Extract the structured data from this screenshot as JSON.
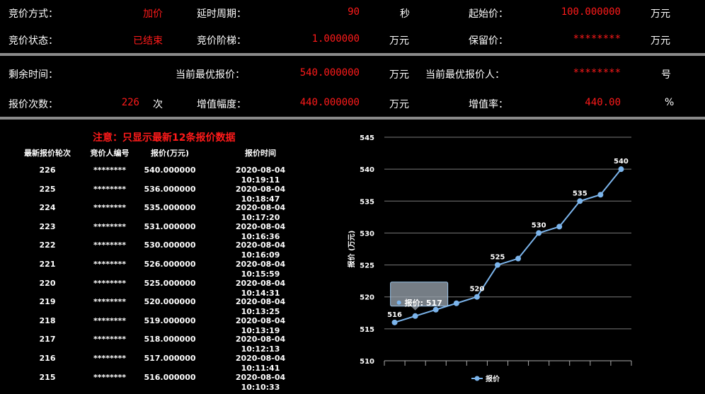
{
  "header": {
    "auction_type_label": "竞价方式：",
    "auction_type_value": "加价",
    "delay_period_label": "延时周期：",
    "delay_period_value": "90",
    "delay_period_unit": "秒",
    "start_price_label": "起始价：",
    "start_price_value": "100.000000",
    "start_price_unit": "万元",
    "status_label": "竞价状态：",
    "status_value": "已结束",
    "step_label": "竞价阶梯：",
    "step_value": "1.000000",
    "step_unit": "万元",
    "reserve_label": "保留价：",
    "reserve_value": "********",
    "reserve_unit": "万元"
  },
  "summary": {
    "remaining_label": "剩余时间：",
    "best_price_label": "当前最优报价：",
    "best_price_value": "540.000000",
    "best_price_unit": "万元",
    "best_bidder_label": "当前最优报价人：",
    "best_bidder_value": "********",
    "best_bidder_unit": "号",
    "bid_count_label": "报价次数：",
    "bid_count_value": "226",
    "bid_count_unit": "次",
    "increase_label": "增值幅度：",
    "increase_value": "440.000000",
    "increase_unit": "万元",
    "rate_label": "增值率：",
    "rate_value": "440.00",
    "rate_unit": "%"
  },
  "table": {
    "notice": "注意：只显示最新12条报价数据",
    "headers": [
      "最新报价轮次",
      "竞价人编号",
      "报价(万元)",
      "报价时间"
    ],
    "rows": [
      [
        "226",
        "********",
        "540.000000",
        "2020-08-04 10:19:11"
      ],
      [
        "225",
        "********",
        "536.000000",
        "2020-08-04 10:18:47"
      ],
      [
        "224",
        "********",
        "535.000000",
        "2020-08-04 10:17:20"
      ],
      [
        "223",
        "********",
        "531.000000",
        "2020-08-04 10:16:36"
      ],
      [
        "222",
        "********",
        "530.000000",
        "2020-08-04 10:16:09"
      ],
      [
        "221",
        "********",
        "526.000000",
        "2020-08-04 10:15:59"
      ],
      [
        "220",
        "********",
        "525.000000",
        "2020-08-04 10:14:31"
      ],
      [
        "219",
        "********",
        "520.000000",
        "2020-08-04 10:13:25"
      ],
      [
        "218",
        "********",
        "519.000000",
        "2020-08-04 10:13:19"
      ],
      [
        "217",
        "********",
        "518.000000",
        "2020-08-04 10:12:13"
      ],
      [
        "216",
        "********",
        "517.000000",
        "2020-08-04 10:11:41"
      ],
      [
        "215",
        "********",
        "516.000000",
        "2020-08-04 10:10:33"
      ]
    ]
  },
  "chart_data": {
    "type": "line",
    "ylabel": "报价 (万元)",
    "ylim": [
      510,
      545
    ],
    "yticks": [
      510,
      515,
      520,
      525,
      530,
      535,
      540,
      545
    ],
    "grid": true,
    "legend": "bottom-center",
    "series": [
      {
        "name": "报价",
        "color": "#7cb5ec",
        "values": [
          516,
          517,
          518,
          519,
          520,
          525,
          526,
          530,
          531,
          535,
          536,
          540
        ]
      }
    ],
    "data_labels": [
      {
        "index": 0,
        "text": "516"
      },
      {
        "index": 4,
        "text": "520"
      },
      {
        "index": 5,
        "text": "525"
      },
      {
        "index": 7,
        "text": "530"
      },
      {
        "index": 9,
        "text": "535"
      },
      {
        "index": 11,
        "text": "540"
      }
    ],
    "tooltip": {
      "index": 1,
      "label": "报价",
      "value": "517"
    }
  }
}
